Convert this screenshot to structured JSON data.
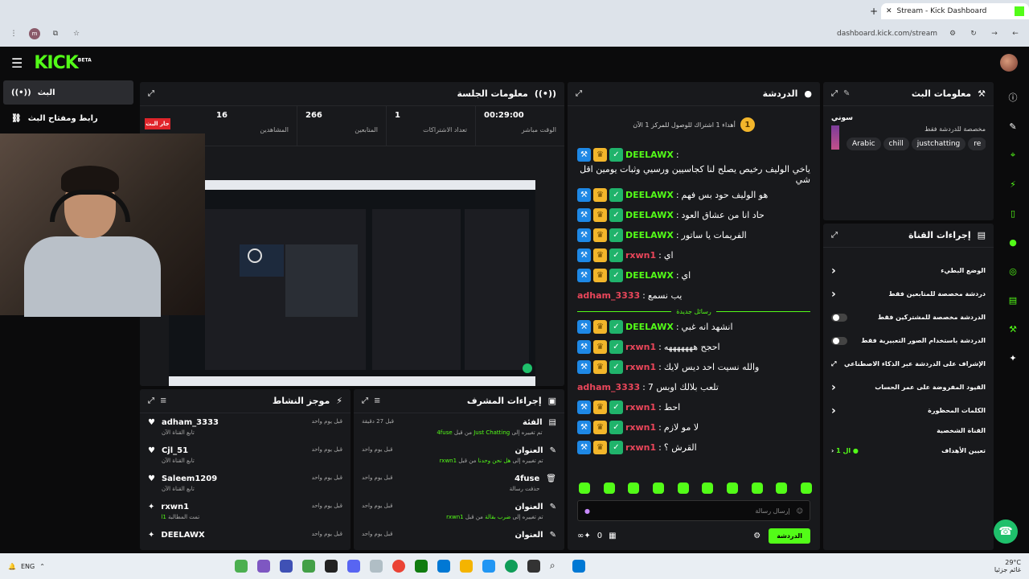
{
  "browser": {
    "tab_title": "Stream - Kick Dashboard",
    "url": "dashboard.kick.com/stream"
  },
  "topbar": {
    "logo": "KICK",
    "logo_sup": "BETA"
  },
  "leftnav": {
    "items": [
      {
        "label": "البث"
      },
      {
        "label": "رابط ومفتاح البث"
      }
    ]
  },
  "session": {
    "title": "معلومات الجلسة",
    "live_badge": "جار البث",
    "stats": [
      {
        "value": "16",
        "label": "المشاهدين"
      },
      {
        "value": "266",
        "label": "المتابعين"
      },
      {
        "value": "1",
        "label": "تعداد الاشتراكات"
      },
      {
        "value": "00:29:00",
        "label": "الوقت مباشر"
      }
    ]
  },
  "activity": {
    "title": "موجز النشاط",
    "rows": [
      {
        "name": "adham_3333",
        "sub": "تابع القناة الآن",
        "time": "قبل يوم واحد",
        "icon": "♥"
      },
      {
        "name": "Cjl_51",
        "sub": "تابع القناة الآن",
        "time": "قبل يوم واحد",
        "icon": "♥"
      },
      {
        "name": "Saleem1209",
        "sub": "تابع القناة الآن",
        "time": "قبل يوم واحد",
        "icon": "♥"
      },
      {
        "name": "rxwn1",
        "sub": "تمت المطالبة",
        "extra": "1ا",
        "time": "قبل يوم واحد",
        "icon": "✦"
      },
      {
        "name": "DEELAWX",
        "sub": "",
        "time": "قبل يوم واحد",
        "icon": "✦"
      }
    ]
  },
  "mod": {
    "title": "إجراءات المشرف",
    "rows": [
      {
        "name": "الفئة",
        "sub_a": "تم تغييره إلى",
        "sub_b": "Just Chatting",
        "sub_c": "من قبل",
        "sub_d": "4fuse",
        "time": "قبل 27 دقيقة",
        "icon": "▤"
      },
      {
        "name": "العنوان",
        "sub_a": "تم تغييره إلى",
        "sub_b": "هل نحن وحدنا",
        "sub_c": "من قبل",
        "sub_d": "rxwn1",
        "time": "قبل يوم واحد",
        "icon": "✎"
      },
      {
        "name": "4fuse",
        "sub_a": "حذفت رسالة",
        "sub_b": "",
        "sub_c": "",
        "sub_d": "",
        "time": "قبل يوم واحد",
        "icon": "🗑"
      },
      {
        "name": "العنوان",
        "sub_a": "تم تغييره إلى",
        "sub_b": "ضرب بقالة",
        "sub_c": "من قبل",
        "sub_d": "rxwn1",
        "time": "قبل يوم واحد",
        "icon": "✎"
      },
      {
        "name": "العنوان",
        "sub_a": "",
        "sub_b": "",
        "sub_c": "",
        "sub_d": "",
        "time": "قبل يوم واحد",
        "icon": "✎"
      }
    ]
  },
  "chat": {
    "title": "الدردشة",
    "pinned": "أهداء 1 اشتراك للوصول للمركز 1 الآن",
    "pinned_rank": "1",
    "new_messages": "رسائل جديدة",
    "messages": [
      {
        "user": "DEELAWX",
        "color": "#53fc18",
        "text": "ياخي الوليف رخيص يصلح لنا كجاسيين ورسيي وثبات يومين اقل شي",
        "badges": true
      },
      {
        "user": "DEELAWX",
        "color": "#53fc18",
        "text": "هو الوليف حود بس فهم",
        "badges": true
      },
      {
        "user": "DEELAWX",
        "color": "#53fc18",
        "text": "حاد انا من عشاق العود",
        "badges": true
      },
      {
        "user": "DEELAWX",
        "color": "#53fc18",
        "text": "الفريمات يا ساتور",
        "badges": true
      },
      {
        "user": "rxwn1",
        "color": "#e9465a",
        "text": "اي",
        "badges": true
      },
      {
        "user": "DEELAWX",
        "color": "#53fc18",
        "text": "اي",
        "badges": true
      },
      {
        "user": "adham_3333",
        "color": "#e9465a",
        "text": "يب نسمع",
        "badges": false
      },
      {
        "user": "DEELAWX",
        "color": "#53fc18",
        "text": "انشهد انه غبي",
        "badges": true
      },
      {
        "user": "rxwn1",
        "color": "#e9465a",
        "text": "احجح هههههههه",
        "badges": true
      },
      {
        "user": "rxwn1",
        "color": "#e9465a",
        "text": "والله نسيت احد ديس لايك",
        "badges": true
      },
      {
        "user": "adham_3333",
        "color": "#e9465a",
        "text": "تلعب بلالك اوبس 7",
        "badges": false
      },
      {
        "user": "rxwn1",
        "color": "#e9465a",
        "text": "احط",
        "badges": true
      },
      {
        "user": "rxwn1",
        "color": "#e9465a",
        "text": "لا مو لازم",
        "badges": true
      },
      {
        "user": "rxwn1",
        "color": "#e9465a",
        "text": "القرش ؟",
        "badges": true
      }
    ],
    "input_placeholder": "إرسال رسالة",
    "count": "0",
    "send_label": "الدردشة"
  },
  "streaminfo": {
    "title": "معلومات البث",
    "streamer": "سوني",
    "category_text": "مخصصة للدردشة فقط",
    "tags": [
      "Arabic",
      "chill",
      "justchatting",
      "re"
    ]
  },
  "channel": {
    "title": "إجراءات القناة",
    "rows": [
      {
        "label": "الوضع البطيء",
        "type": "chevron"
      },
      {
        "label": "دردشة مخصصة للمتابعين فقط",
        "type": "chevron"
      },
      {
        "label": "الدردشة مخصصة للمشتركين فقط",
        "type": "toggle"
      },
      {
        "label": "الدردشة باستخدام الصور التعبيرية فقط",
        "type": "toggle"
      },
      {
        "label": "الإشراف على الدردشة عبر الذكاء الاصطناعي",
        "type": "link"
      },
      {
        "label": "القيود المفروضة على عمر الحساب",
        "type": "chevron"
      },
      {
        "label": "الكلمات المحظورة",
        "type": "chevron"
      }
    ],
    "section_label": "القناة الشخصية",
    "goal_label": "تعيين الأهداف",
    "goal_value": "1 ال"
  },
  "taskbar": {
    "lang": "ENG",
    "weather": "29°C",
    "weather_sub": "غائم جزئيا"
  }
}
